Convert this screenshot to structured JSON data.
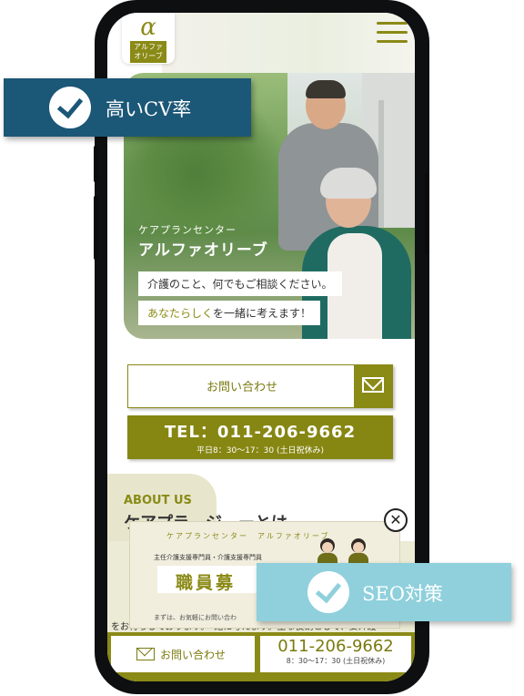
{
  "site": {
    "logo_symbol": "α",
    "logo_text": "アルファ オリーブ",
    "menu_icon": "hamburger-icon"
  },
  "hero": {
    "subtitle": "ケアプランセンター",
    "title": "アルファオリーブ",
    "line1": "介護のこと、何でもご相談ください。",
    "line2_highlight": "あなたらしく",
    "line2_rest": "を一緒に考えます！"
  },
  "contact_button": {
    "label": "お問い合わせ",
    "icon": "mail-icon"
  },
  "tel_button": {
    "number": "TEL：011-206-9662",
    "hours": "平日8：30〜17：30 (土日祝休み)"
  },
  "about": {
    "heading": "ABOUT US",
    "title": "ケアプラ　ジ　ーとは",
    "body": "をお待ちしております。・緒に考えます。主な役割として、要介護"
  },
  "recruit_popup": {
    "header": "ケアプランセンター　アルファオリーブ",
    "subtitle": "主任介護支援専門員・介護支援専門員",
    "title": "職員募",
    "footer": "まずは、お気軽にお問い合わ",
    "close_icon": "close-icon"
  },
  "bottom_bar": {
    "contact_label": "お問い合わせ",
    "tel_number": "011-206-9662",
    "tel_hours": "8：30〜17：30 (土日祝休み)"
  },
  "badges": {
    "cv": "高いCV率",
    "seo": "SEO対策",
    "icon": "check-icon"
  },
  "colors": {
    "olive": "#8a8a16",
    "badge_blue": "#1b5777",
    "badge_light_blue": "#8fd0dc"
  }
}
